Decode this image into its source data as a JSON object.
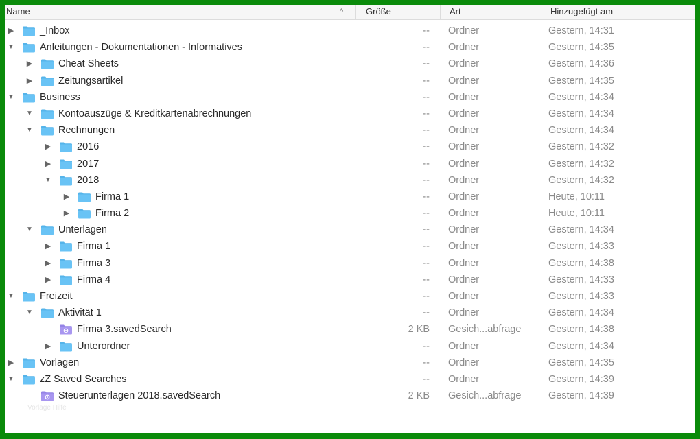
{
  "columns": {
    "name": "Name",
    "size": "Größe",
    "kind": "Art",
    "date": "Hinzugefügt am",
    "sort_indicator": "^"
  },
  "colors": {
    "folder_blue": "#69c3f5",
    "folder_blue_tab": "#55b4ea",
    "search_purple": "#a896f0",
    "disclosure": "#666666",
    "text_muted": "#8a8a8a"
  },
  "rows": [
    {
      "name": "_Inbox",
      "level": 0,
      "disclosure": "collapsed",
      "icon": "folder-icon",
      "size": "--",
      "kind": "Ordner",
      "date": "Gestern, 14:31"
    },
    {
      "name": "Anleitungen - Dokumentationen - Informatives",
      "level": 0,
      "disclosure": "expanded",
      "icon": "folder-icon",
      "size": "--",
      "kind": "Ordner",
      "date": "Gestern, 14:35"
    },
    {
      "name": "Cheat Sheets",
      "level": 1,
      "disclosure": "collapsed",
      "icon": "folder-icon",
      "size": "--",
      "kind": "Ordner",
      "date": "Gestern, 14:36"
    },
    {
      "name": "Zeitungsartikel",
      "level": 1,
      "disclosure": "collapsed",
      "icon": "folder-icon",
      "size": "--",
      "kind": "Ordner",
      "date": "Gestern, 14:35"
    },
    {
      "name": "Business",
      "level": 0,
      "disclosure": "expanded",
      "icon": "folder-icon",
      "size": "--",
      "kind": "Ordner",
      "date": "Gestern, 14:34"
    },
    {
      "name": "Kontoauszüge & Kreditkartenabrechnungen",
      "level": 1,
      "disclosure": "expanded",
      "icon": "folder-icon",
      "size": "--",
      "kind": "Ordner",
      "date": "Gestern, 14:34"
    },
    {
      "name": "Rechnungen",
      "level": 1,
      "disclosure": "expanded",
      "icon": "folder-icon",
      "size": "--",
      "kind": "Ordner",
      "date": "Gestern, 14:34"
    },
    {
      "name": "2016",
      "level": 2,
      "disclosure": "collapsed",
      "icon": "folder-icon",
      "size": "--",
      "kind": "Ordner",
      "date": "Gestern, 14:32"
    },
    {
      "name": "2017",
      "level": 2,
      "disclosure": "collapsed",
      "icon": "folder-icon",
      "size": "--",
      "kind": "Ordner",
      "date": "Gestern, 14:32"
    },
    {
      "name": "2018",
      "level": 2,
      "disclosure": "expanded",
      "icon": "folder-icon",
      "size": "--",
      "kind": "Ordner",
      "date": "Gestern, 14:32"
    },
    {
      "name": "Firma 1",
      "level": 3,
      "disclosure": "collapsed",
      "icon": "folder-icon",
      "size": "--",
      "kind": "Ordner",
      "date": "Heute, 10:11"
    },
    {
      "name": "Firma 2",
      "level": 3,
      "disclosure": "collapsed",
      "icon": "folder-icon",
      "size": "--",
      "kind": "Ordner",
      "date": "Heute, 10:11"
    },
    {
      "name": "Unterlagen",
      "level": 1,
      "disclosure": "expanded",
      "icon": "folder-icon",
      "size": "--",
      "kind": "Ordner",
      "date": "Gestern, 14:34"
    },
    {
      "name": "Firma 1",
      "level": 2,
      "disclosure": "collapsed",
      "icon": "folder-icon",
      "size": "--",
      "kind": "Ordner",
      "date": "Gestern, 14:33"
    },
    {
      "name": "Firma 3",
      "level": 2,
      "disclosure": "collapsed",
      "icon": "folder-icon",
      "size": "--",
      "kind": "Ordner",
      "date": "Gestern, 14:38"
    },
    {
      "name": "Firma 4",
      "level": 2,
      "disclosure": "collapsed",
      "icon": "folder-icon",
      "size": "--",
      "kind": "Ordner",
      "date": "Gestern, 14:33"
    },
    {
      "name": "Freizeit",
      "level": 0,
      "disclosure": "expanded",
      "icon": "folder-icon",
      "size": "--",
      "kind": "Ordner",
      "date": "Gestern, 14:33"
    },
    {
      "name": "Aktivität 1",
      "level": 1,
      "disclosure": "expanded",
      "icon": "folder-icon",
      "size": "--",
      "kind": "Ordner",
      "date": "Gestern, 14:34"
    },
    {
      "name": "Firma 3.savedSearch",
      "level": 2,
      "disclosure": "none",
      "icon": "saved-search-icon",
      "size": "2 KB",
      "kind": "Gesich...abfrage",
      "date": "Gestern, 14:38"
    },
    {
      "name": "Unterordner",
      "level": 2,
      "disclosure": "collapsed",
      "icon": "folder-icon",
      "size": "--",
      "kind": "Ordner",
      "date": "Gestern, 14:34"
    },
    {
      "name": "Vorlagen",
      "level": 0,
      "disclosure": "collapsed",
      "icon": "folder-icon",
      "size": "--",
      "kind": "Ordner",
      "date": "Gestern, 14:35"
    },
    {
      "name": "zZ Saved Searches",
      "level": 0,
      "disclosure": "expanded",
      "icon": "folder-icon",
      "size": "--",
      "kind": "Ordner",
      "date": "Gestern, 14:39"
    },
    {
      "name": "Steuerunterlagen 2018.savedSearch",
      "level": 1,
      "disclosure": "none",
      "icon": "saved-search-icon",
      "size": "2 KB",
      "kind": "Gesich...abfrage",
      "date": "Gestern, 14:39"
    }
  ],
  "watermark": "Vorlage Hilfe"
}
